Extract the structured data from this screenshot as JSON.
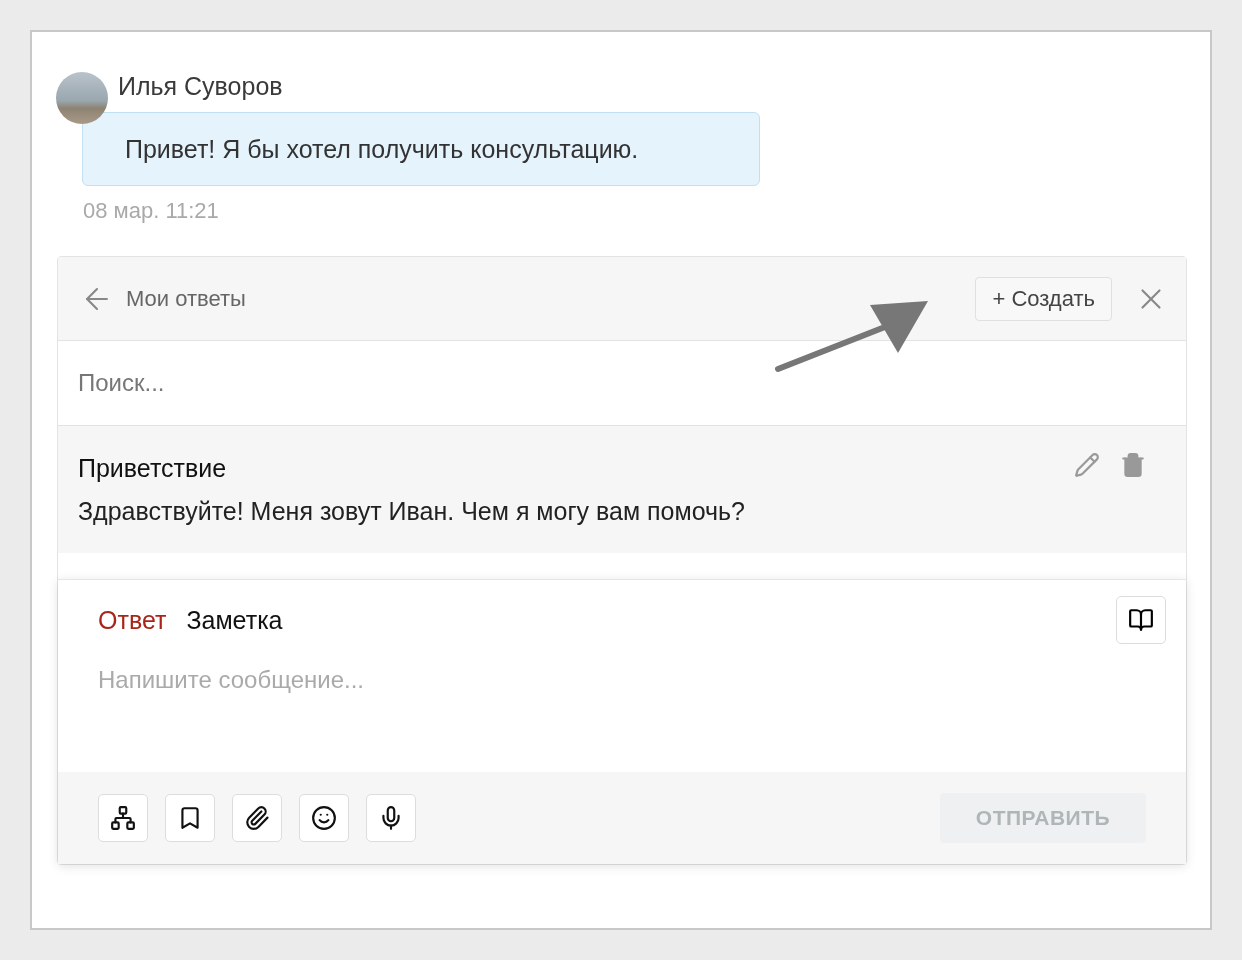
{
  "message": {
    "author": "Илья Суворов",
    "text": "Привет! Я бы хотел получить консультацию.",
    "time": "08 мар. 11:21"
  },
  "replies_panel": {
    "title": "Мои ответы",
    "create_button": "+ Создать",
    "search": {
      "placeholder": "Поиск..."
    },
    "items": [
      {
        "title": "Приветствие",
        "text": "Здравствуйте! Меня зовут Иван. Чем я могу вам помочь?"
      }
    ]
  },
  "composer": {
    "tabs": [
      {
        "label": "Ответ",
        "selected": true
      },
      {
        "label": "Заметка",
        "selected": false
      }
    ],
    "placeholder": "Напишите сообщение...",
    "send_button": {
      "label": "ОТПРАВИТЬ",
      "disabled": true
    }
  }
}
